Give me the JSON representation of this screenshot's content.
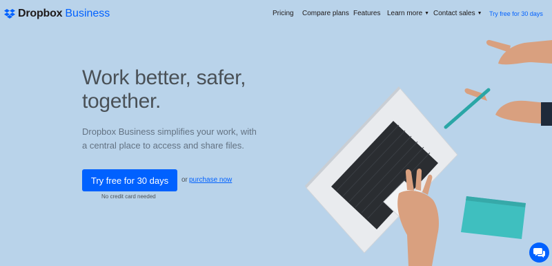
{
  "brand": {
    "name": "Dropbox",
    "suffix": "Business"
  },
  "nav": {
    "pricing": "Pricing",
    "compare": "Compare plans",
    "features": "Features",
    "learn_more": "Learn more",
    "contact_sales": "Contact sales",
    "try_free": "Try free for 30 days"
  },
  "hero": {
    "headline_line1": "Work better, safer,",
    "headline_line2": "together.",
    "subhead_line1": "Dropbox Business simplifies your work, with",
    "subhead_line2": "a central place to access and share files.",
    "cta": "Try free for 30 days",
    "or": "or",
    "purchase": "purchase now",
    "note": "No credit card needed"
  },
  "colors": {
    "background": "#b9d3ea",
    "accent": "#0061ff",
    "notebook": "#3fbfbf"
  },
  "icons": {
    "logo": "dropbox-logo-icon",
    "chat": "chat-bubble-icon",
    "caret": "caret-down-icon"
  }
}
